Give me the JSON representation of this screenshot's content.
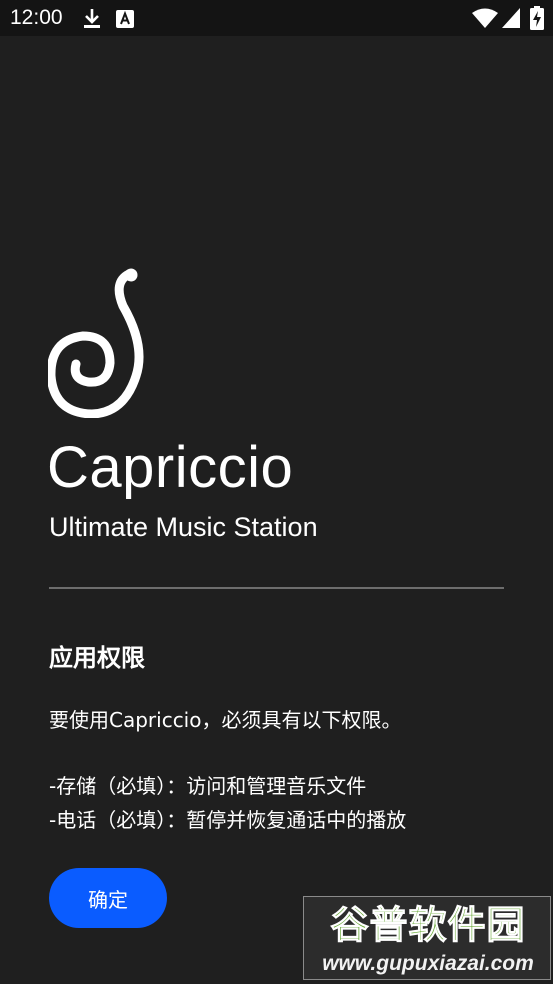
{
  "status_bar": {
    "time": "12:00",
    "left_icons": [
      "download-icon",
      "font-a-icon"
    ],
    "right_icons": [
      "wifi-icon",
      "signal-icon",
      "battery-charging-icon"
    ]
  },
  "app": {
    "name": "Capriccio",
    "subtitle": "Ultimate Music Station",
    "logo_icon": "treble-swirl-logo-icon"
  },
  "permissions": {
    "title": "应用权限",
    "intro": "要使用Capriccio，必须具有以下权限。",
    "items": [
      "-存储（必填）：访问和管理音乐文件",
      "-电话（必填）：暂停并恢复通话中的播放"
    ]
  },
  "actions": {
    "confirm_label": "确定"
  },
  "watermark": {
    "title": "谷普软件园",
    "url": "www.gupuxiazai.com"
  },
  "colors": {
    "background": "#1f1f1f",
    "status_bar": "#141414",
    "accent_button": "#0a5cff",
    "divider": "#6d6d6d",
    "watermark_green": "#62a52f"
  }
}
